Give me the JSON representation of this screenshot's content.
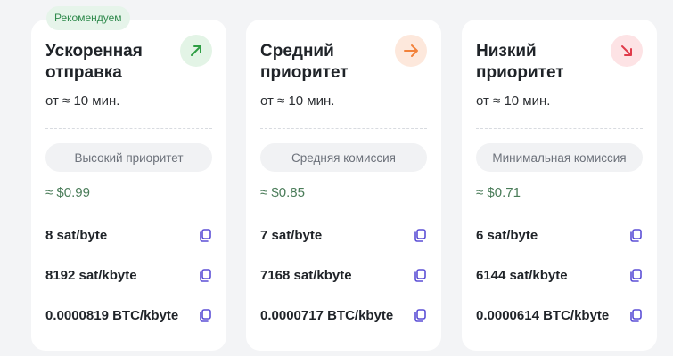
{
  "badge": {
    "recommended": "Рекомендуем"
  },
  "cards": [
    {
      "title": "Ускоренная отправка",
      "eta": "от ≈ 10 мин.",
      "priority": "Высокий приоритет",
      "usd": "≈ $0.99",
      "icon": "arrow-up-right-icon",
      "accent": "#2f9e44",
      "rows": [
        "8 sat/byte",
        "8192 sat/kbyte",
        "0.0000819 BTC/kbyte"
      ]
    },
    {
      "title": "Средний приоритет",
      "eta": "от ≈ 10 мин.",
      "priority": "Средняя комиссия",
      "usd": "≈ $0.85",
      "icon": "arrow-right-icon",
      "accent": "#f2823b",
      "rows": [
        "7 sat/byte",
        "7168 sat/kbyte",
        "0.0000717 BTC/kbyte"
      ]
    },
    {
      "title": "Низкий приоритет",
      "eta": "от ≈ 10 мин.",
      "priority": "Минимальная комиссия",
      "usd": "≈ $0.71",
      "icon": "arrow-down-right-icon",
      "accent": "#e03b4a",
      "rows": [
        "6 sat/byte",
        "6144 sat/kbyte",
        "0.0000614 BTC/kbyte"
      ]
    }
  ],
  "colors": {
    "copy_icon": "#5b4fd6",
    "usd_text": "#4a7c59"
  }
}
